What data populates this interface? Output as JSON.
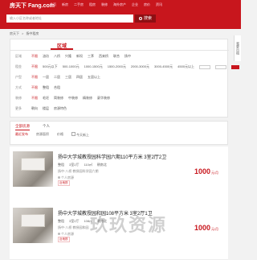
{
  "header": {
    "logo": "房天下 Fang.com",
    "nav": [
      "首页",
      "新房",
      "二手房",
      "租房",
      "装修",
      "海外房产",
      "企业",
      "房价",
      "资讯"
    ]
  },
  "search": {
    "placeholder": "输入小区名称或者地址",
    "button_label": "搜索"
  },
  "side_tab": "我要出租",
  "breadcrumb": [
    "房天下",
    "扬中租房"
  ],
  "filters": {
    "tab_label": "区域",
    "rows": [
      {
        "label": "区域",
        "options": [
          "不限",
          "油坊",
          "八桥",
          "兴隆",
          "新坝",
          "三茅",
          "西来桥",
          "联合",
          "八桥",
          "扬中"
        ]
      },
      {
        "label": "租金",
        "options": [
          "不限",
          "500元以下",
          "500-1000元",
          "1000-1500元",
          "1500-2000元",
          "2000-3000元",
          "3000-4500元",
          "4500元以上"
        ]
      },
      {
        "label": "户型",
        "options": [
          "不限",
          "一居",
          "二居",
          "三居",
          "四居",
          "五居以上"
        ]
      },
      {
        "label": "方式",
        "options": [
          "不限",
          "整租",
          "合租"
        ]
      },
      {
        "label": "装修",
        "options": [
          "不限",
          "毛坯",
          "简装修",
          "中装修",
          "精装修",
          "豪华装修"
        ]
      },
      {
        "label": "更多",
        "options": [
          "朝向",
          "楼层",
          "房源特色"
        ]
      }
    ]
  },
  "sort": {
    "tabs": [
      "全部房源",
      "个人"
    ],
    "options": [
      "最近发布",
      "房源面积",
      "价格",
      "今天新上"
    ]
  },
  "listings": [
    {
      "title": "扬中大学城教授园科学园六期110平方米 3室2厅2卫",
      "type": "整租",
      "layout": "3室2厅",
      "area": "110㎡",
      "orientation": "朝南北",
      "address": "扬中·八桥 教授园科学园六期",
      "agent": "个人房源",
      "tags": [
        "近地铁"
      ],
      "price": "1000",
      "unit": "元/月"
    },
    {
      "title": "扬中大学城教授园和园108平方米 3室2厅1卫",
      "type": "整租",
      "layout": "3室2厅",
      "area": "108㎡",
      "orientation": "朝南北",
      "address": "扬中·八桥 教授园和园",
      "agent": "个人房源",
      "tags": [
        "近地铁"
      ],
      "price": "1000",
      "unit": "元/月"
    }
  ],
  "watermark": "玖玖资源",
  "colors": {
    "brand_red": "#c8161d"
  }
}
